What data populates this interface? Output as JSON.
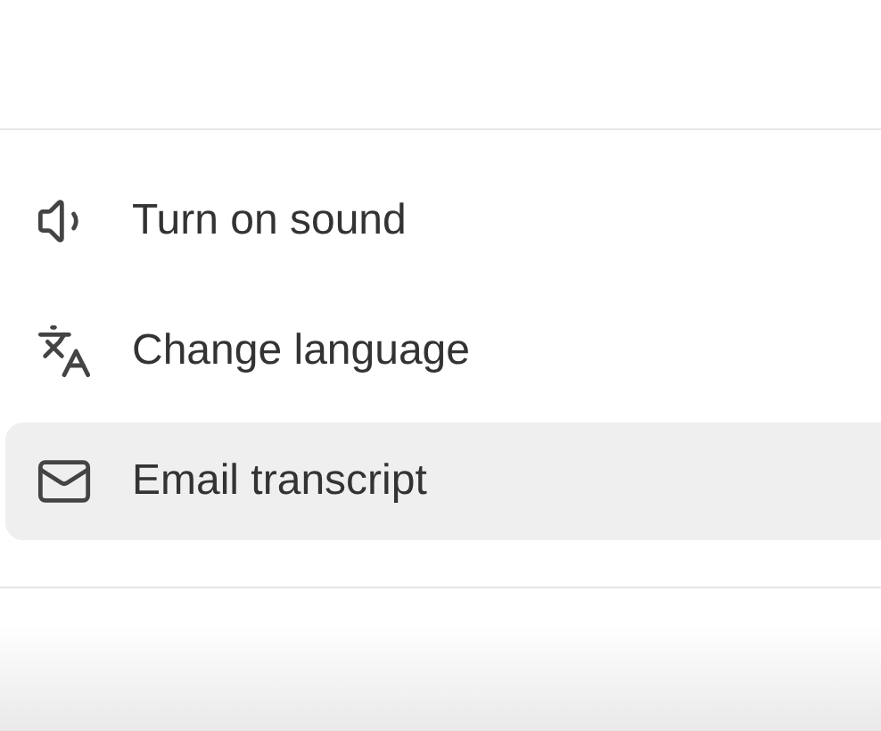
{
  "menu": {
    "items": [
      {
        "label": "Turn on sound",
        "selected": false
      },
      {
        "label": "Change language",
        "selected": false
      },
      {
        "label": "Email transcript",
        "selected": true
      }
    ]
  }
}
